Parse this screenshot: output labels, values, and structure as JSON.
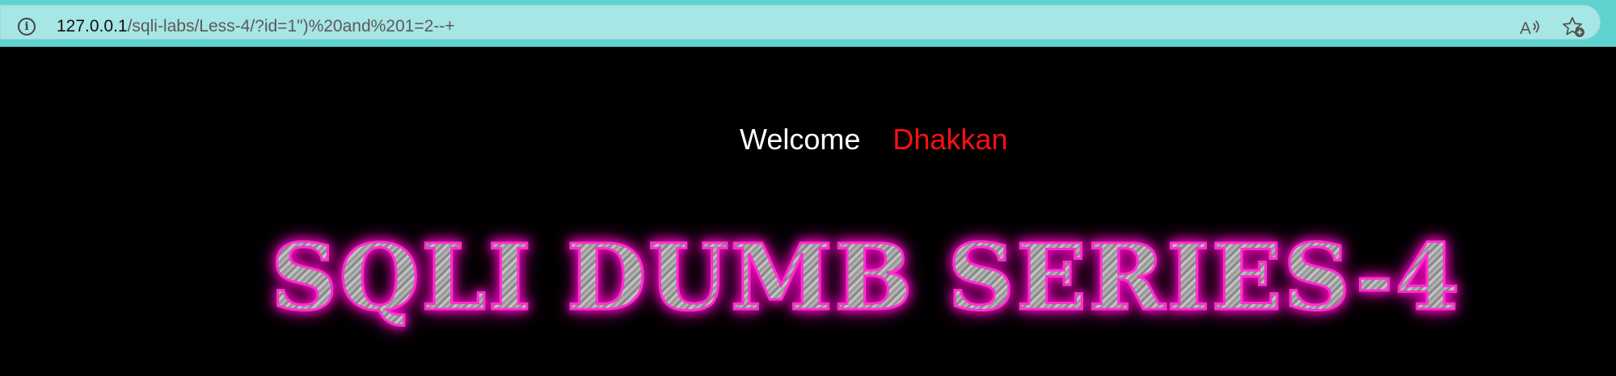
{
  "browser": {
    "url_host": "127.0.0.1",
    "url_path": "/sqli-labs/Less-4/?id=1\")%20and%201=2--+",
    "icons": [
      "info-icon",
      "read-aloud-icon",
      "favorite-star-icon"
    ]
  },
  "page": {
    "welcome_label": "Welcome",
    "user_name": "Dhakkan",
    "title": "SQLI DUMB SERIES-4"
  },
  "colors": {
    "toolbar_bg": "#5fd3cf",
    "address_bg": "#a6e6e4",
    "page_bg": "#000000",
    "welcome": "#ffffff",
    "user_name": "#ff1010",
    "title_glow": "#ff2fd0"
  }
}
